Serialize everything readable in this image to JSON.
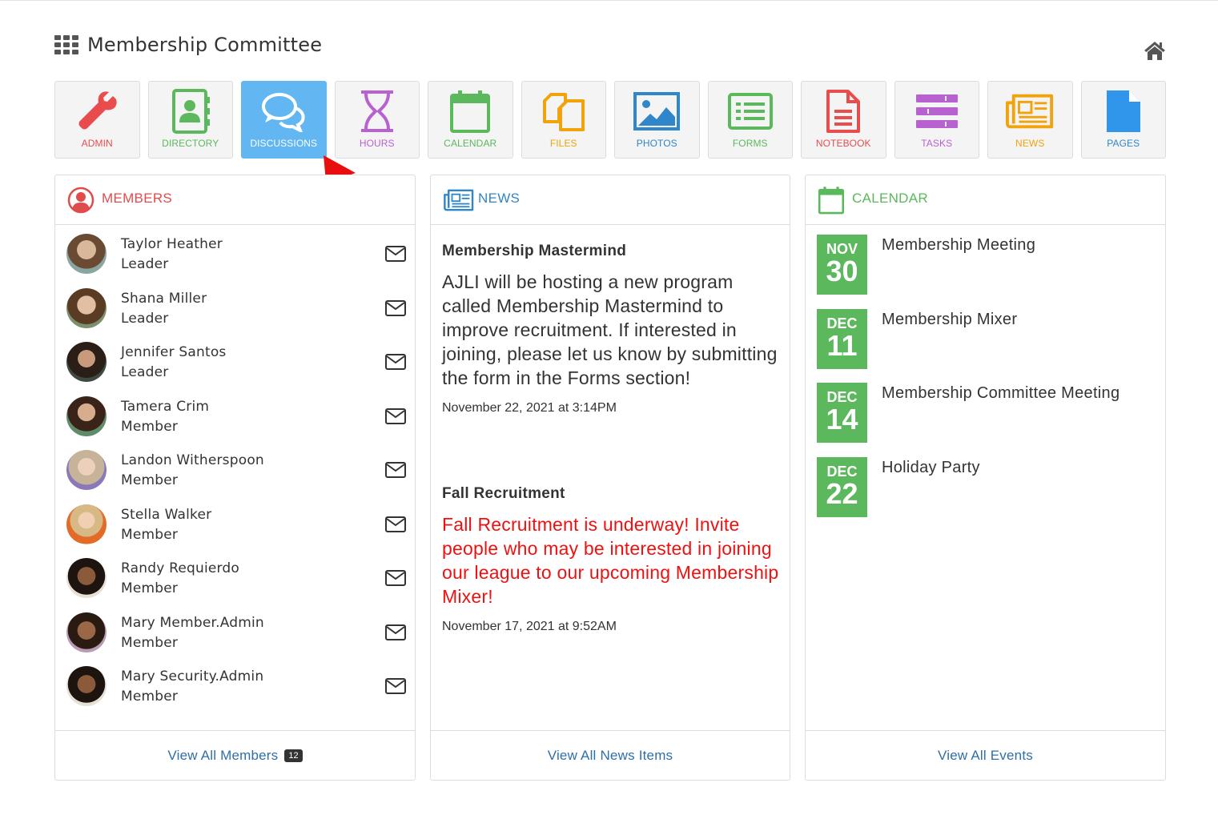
{
  "header": {
    "title": "Membership Committee"
  },
  "tiles": [
    {
      "label": "ADMIN",
      "color": "#e84c4c"
    },
    {
      "label": "DIRECTORY",
      "color": "#5cb85c"
    },
    {
      "label": "DISCUSSIONS",
      "color": "#ffffff"
    },
    {
      "label": "HOURS",
      "color": "#b861d1"
    },
    {
      "label": "CALENDAR",
      "color": "#5cb85c"
    },
    {
      "label": "FILES",
      "color": "#f0a30a"
    },
    {
      "label": "PHOTOS",
      "color": "#2f86c8"
    },
    {
      "label": "FORMS",
      "color": "#5cb85c"
    },
    {
      "label": "NOTEBOOK",
      "color": "#e84c4c"
    },
    {
      "label": "TASKS",
      "color": "#b861d1"
    },
    {
      "label": "NEWS",
      "color": "#f0a30a"
    },
    {
      "label": "PAGES",
      "color": "#2f86c8"
    }
  ],
  "members": {
    "title": "MEMBERS",
    "list": [
      {
        "name": "Taylor Heather",
        "role": "Leader"
      },
      {
        "name": "Shana Miller",
        "role": "Leader"
      },
      {
        "name": "Jennifer Santos",
        "role": "Leader"
      },
      {
        "name": "Tamera Crim",
        "role": "Member"
      },
      {
        "name": "Landon Witherspoon",
        "role": "Member"
      },
      {
        "name": "Stella Walker",
        "role": "Member"
      },
      {
        "name": "Randy Requierdo",
        "role": "Member"
      },
      {
        "name": "Mary Member.Admin",
        "role": "Member"
      },
      {
        "name": "Mary Security.Admin",
        "role": "Member"
      }
    ],
    "footer_label": "View All Members",
    "count": "12"
  },
  "news": {
    "title": "NEWS",
    "items": [
      {
        "title": "Membership Mastermind",
        "body": "AJLI will be hosting a new program called Membership Mastermind to improve recruitment. If interested in joining, please let us know by submitting the form in the Forms section!",
        "date": "November 22, 2021 at 3:14PM"
      },
      {
        "title": "Fall Recruitment",
        "body": "Fall Recruitment is underway! Invite people who may be interested in joining our league to our upcoming Membership Mixer!",
        "date": "November 17, 2021 at 9:52AM"
      }
    ],
    "footer_label": "View All News Items"
  },
  "calendar": {
    "title": "CALENDAR",
    "events": [
      {
        "month": "NOV",
        "day": "30",
        "title": "Membership Meeting"
      },
      {
        "month": "DEC",
        "day": "11",
        "title": "Membership Mixer"
      },
      {
        "month": "DEC",
        "day": "14",
        "title": "Membership Committee Meeting"
      },
      {
        "month": "DEC",
        "day": "22",
        "title": "Holiday Party"
      }
    ],
    "footer_label": "View All Events"
  },
  "colors": {
    "members_accent": "#e04b4b",
    "news_accent": "#2f86c8",
    "calendar_accent": "#5cb85c",
    "active_tile": "#62b7f3",
    "news_alert_text": "#ee1111"
  }
}
